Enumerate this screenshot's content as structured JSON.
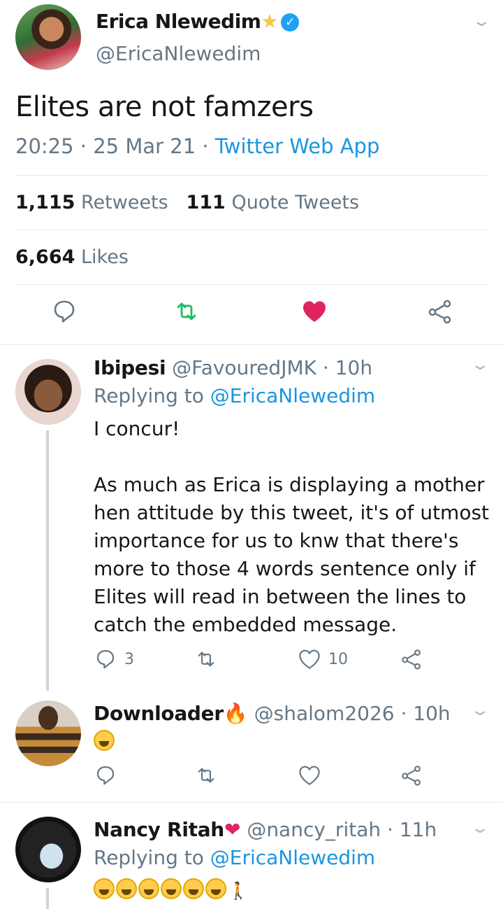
{
  "main_tweet": {
    "author_name": "Erica Nlewedim",
    "name_emoji": "⭐",
    "handle": "@EricaNlewedim",
    "text": "Elites are not famzers",
    "time": "20:25",
    "date": "25 Mar 21",
    "source": "Twitter Web App",
    "retweets_count": "1,115",
    "retweets_label": "Retweets",
    "quotes_count": "111",
    "quotes_label": "Quote Tweets",
    "likes_count": "6,664",
    "likes_label": "Likes",
    "liked": true,
    "colors": {
      "like": "#e0245e",
      "retweet": "#17bf63",
      "link": "#1b95e0",
      "muted": "#657786"
    }
  },
  "replies": [
    {
      "name": "Ibipesi",
      "handle": "@FavouredJMK",
      "time": "10h",
      "replying_prefix": "Replying to",
      "replying_to": "@EricaNlewedim",
      "text_lines": [
        "I concur!",
        "",
        "As much as Erica is displaying a mother",
        "hen attitude by this tweet, it's of utmost",
        "importance for us to knw that there's",
        "more to those 4 words sentence only if",
        "Elites will read in between the lines to",
        "catch the embedded message."
      ],
      "reply_count": "3",
      "like_count": "10"
    },
    {
      "name": "Downloader",
      "name_emoji": "🔥",
      "handle": "@shalom2026",
      "time": "10h",
      "text_emoji_count": 1
    },
    {
      "name": "Nancy Ritah",
      "name_emoji": "❤️",
      "handle": "@nancy_ritah",
      "time": "11h",
      "replying_prefix": "Replying to",
      "replying_to": "@EricaNlewedim",
      "text_emoji_count": 6,
      "trailing_emoji": "🚶‍♀️"
    }
  ],
  "icons": [
    "reply-icon",
    "retweet-icon",
    "like-icon",
    "share-icon",
    "chevron-down-icon",
    "verified-badge-icon"
  ]
}
